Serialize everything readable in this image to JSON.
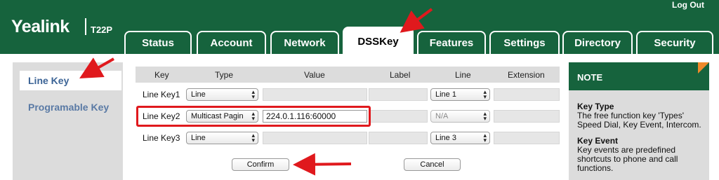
{
  "header": {
    "logo": "Yealink",
    "model": "T22P",
    "logout": "Log Out",
    "tabs": [
      {
        "label": "Status"
      },
      {
        "label": "Account"
      },
      {
        "label": "Network"
      },
      {
        "label": "DSSKey",
        "active": true
      },
      {
        "label": "Features"
      },
      {
        "label": "Settings"
      },
      {
        "label": "Directory"
      },
      {
        "label": "Security"
      }
    ]
  },
  "sidebar": {
    "items": [
      {
        "label": "Line Key",
        "active": true
      },
      {
        "label": "Programable Key"
      }
    ]
  },
  "table": {
    "headers": [
      "Key",
      "Type",
      "Value",
      "Label",
      "Line",
      "Extension"
    ],
    "rows": [
      {
        "key": "Line Key1",
        "type": "Line",
        "value": "",
        "label": "",
        "line": "Line 1",
        "extension": ""
      },
      {
        "key": "Line Key2",
        "type": "Multicast Pagin",
        "value": "224.0.1.116:60000",
        "label": "",
        "line": "N/A",
        "extension": ""
      },
      {
        "key": "Line Key3",
        "type": "Line",
        "value": "",
        "label": "",
        "line": "Line 3",
        "extension": ""
      }
    ]
  },
  "buttons": {
    "confirm": "Confirm",
    "cancel": "Cancel"
  },
  "note": {
    "title": "NOTE",
    "sections": [
      {
        "heading": "Key Type",
        "text": "The free function key 'Types' Speed Dial, Key Event, Intercom."
      },
      {
        "heading": "Key Event",
        "text": "Key events are predefined shortcuts to phone and call functions."
      }
    ]
  },
  "colors": {
    "brand_green": "#16633d",
    "highlight_red": "#e0191d",
    "note_corner": "#f08a2a"
  }
}
